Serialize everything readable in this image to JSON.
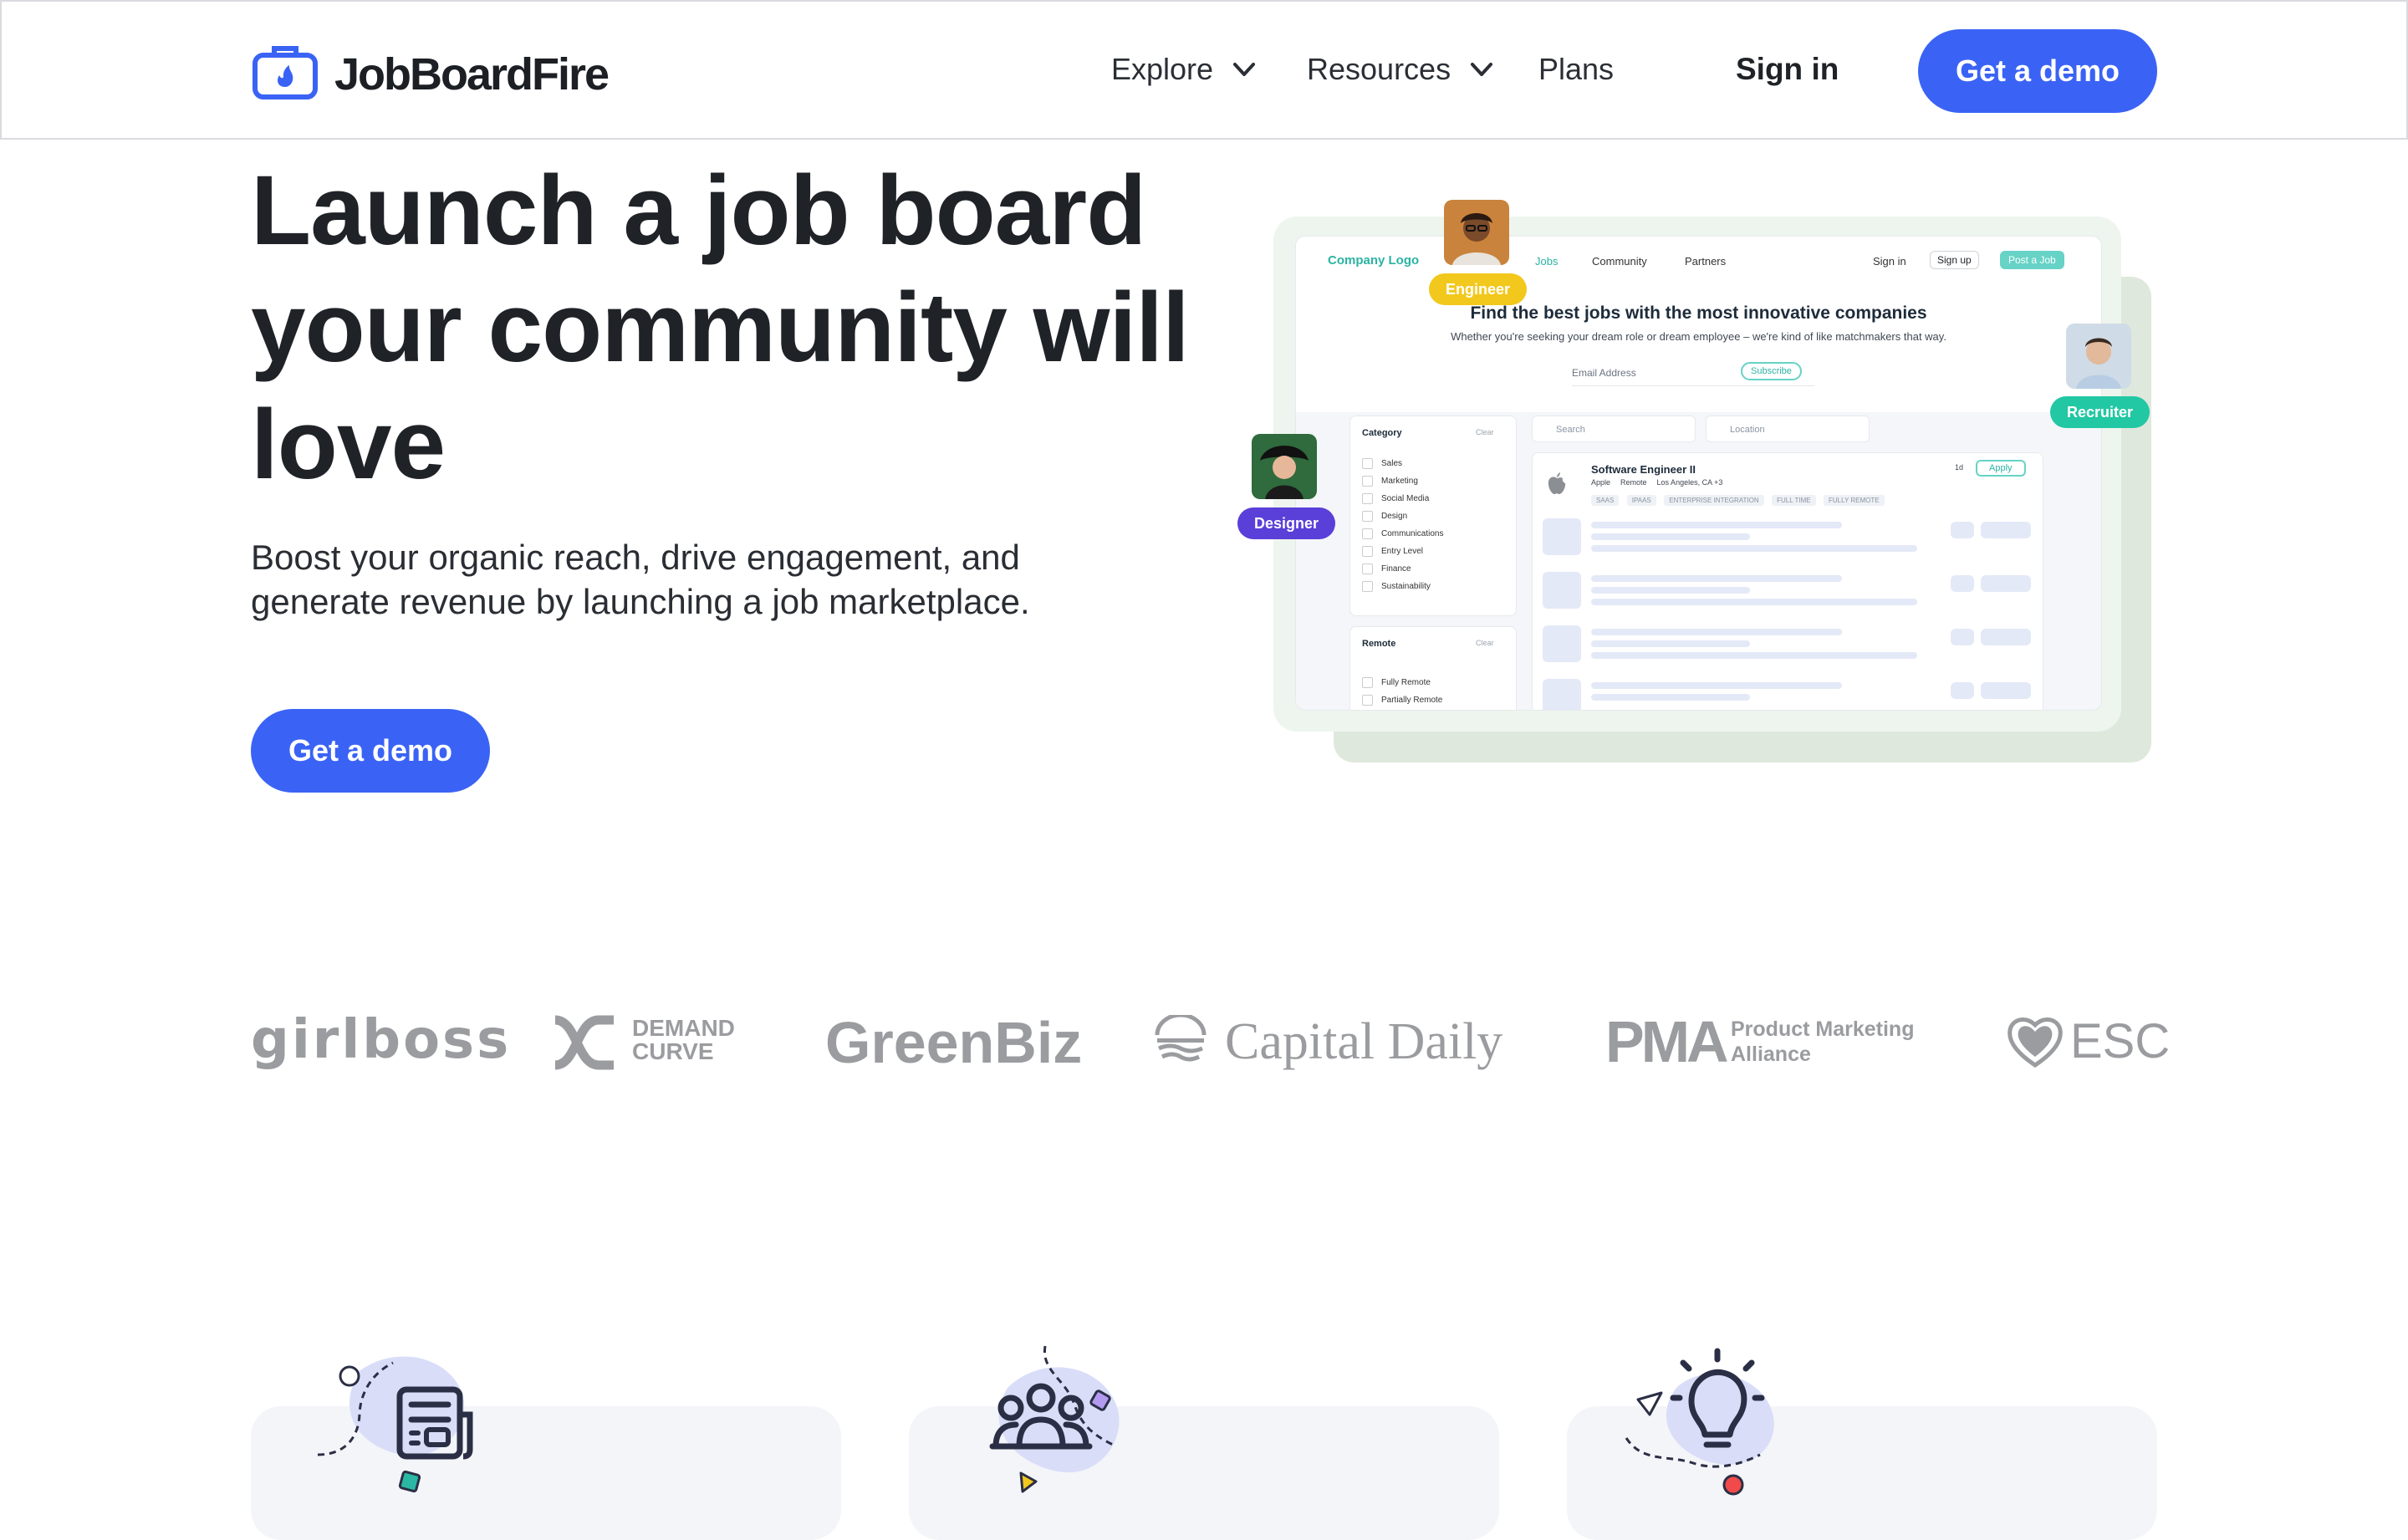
{
  "header": {
    "logo_text": "JobBoardFire",
    "nav": [
      {
        "label": "Explore",
        "has_dropdown": true
      },
      {
        "label": "Resources",
        "has_dropdown": true
      },
      {
        "label": "Plans",
        "has_dropdown": false
      }
    ],
    "sign_in": "Sign in",
    "cta": "Get a demo"
  },
  "hero": {
    "title_lines": [
      "Launch a job board",
      "your community will",
      "love"
    ],
    "subtitle_lines": [
      "Boost your organic reach, drive engagement, and",
      "generate revenue by launching a job marketplace."
    ],
    "cta": "Get a demo"
  },
  "mockup": {
    "company_logo": "Company Logo",
    "nav": [
      "Jobs",
      "Community",
      "Partners"
    ],
    "sign_in": "Sign in",
    "sign_up": "Sign up",
    "post_job": "Post a Job",
    "headline": "Find the best jobs with the most innovative companies",
    "subline": "Whether you're seeking your dream role or dream employee – we're kind of like matchmakers that way.",
    "email_placeholder": "Email Address",
    "subscribe": "Subscribe",
    "category_title": "Category",
    "clear": "Clear",
    "categories": [
      "Sales",
      "Marketing",
      "Social Media",
      "Design",
      "Communications",
      "Entry Level",
      "Finance",
      "Sustainability"
    ],
    "remote_title": "Remote",
    "remote_options": [
      "Fully Remote",
      "Partially Remote"
    ],
    "search_placeholder": "Search",
    "location_placeholder": "Location",
    "job": {
      "title": "Software Engineer II",
      "company": "Apple",
      "mode": "Remote",
      "location": "Los Angeles, CA +3",
      "age": "1d",
      "apply": "Apply",
      "tags": [
        "SAAS",
        "IPAAS",
        "ENTERPRISE INTEGRATION",
        "FULL TIME",
        "FULLY REMOTE"
      ]
    },
    "chips": {
      "engineer": "Engineer",
      "recruiter": "Recruiter",
      "designer": "Designer"
    },
    "colors": {
      "engineer": "#f2c81d",
      "recruiter": "#22c7a3",
      "designer": "#5a3fd8",
      "teal": "#2bb3a3"
    }
  },
  "logos": {
    "girlboss": "girlboss",
    "demand_curve_1": "DEMAND",
    "demand_curve_2": "CURVE",
    "greenbiz": "GreenBiz",
    "capital_daily": "Capital Daily",
    "pma": "PMA",
    "pma_sub_1": "Product Marketing",
    "pma_sub_2": "Alliance",
    "esc": "ESC"
  },
  "features": {
    "icons": [
      "newspaper-icon",
      "community-icon",
      "lightbulb-icon"
    ]
  },
  "colors": {
    "accent": "#3a63f5",
    "card_bg": "#f4f5f9"
  }
}
